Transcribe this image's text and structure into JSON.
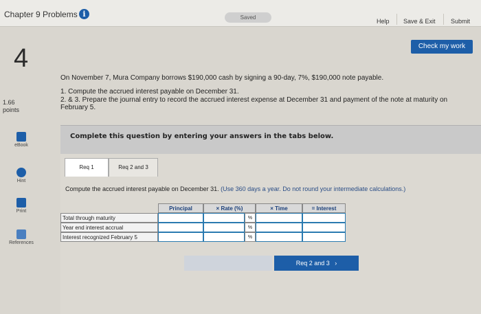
{
  "header": {
    "title": "Chapter 9 Problems",
    "info_icon": "i",
    "status": "Saved",
    "help": "Help",
    "save_exit": "Save & Exit",
    "submit": "Submit"
  },
  "check_work": "Check my work",
  "question": {
    "number": "4",
    "points_value": "1.66",
    "points_label": "points",
    "prompt": "On November 7, Mura Company borrows $190,000 cash by signing a 90-day, 7%, $190,000 note payable.",
    "task1": "1. Compute the accrued interest payable on December 31.",
    "task2": "2. & 3. Prepare the journal entry to record the accrued interest expense at December 31 and payment of the note at maturity on February 5."
  },
  "banner": "Complete this question by entering your answers in the tabs below.",
  "sidebar": {
    "items": [
      {
        "label": "eBook",
        "icon": "ebook-icon"
      },
      {
        "label": "Hint",
        "icon": "hint-icon"
      },
      {
        "label": "Print",
        "icon": "print-icon"
      },
      {
        "label": "References",
        "icon": "references-icon"
      }
    ]
  },
  "tabs": [
    {
      "label": "Req 1"
    },
    {
      "label": "Req 2 and 3"
    }
  ],
  "instruction": {
    "main": "Compute the accrued interest payable on December 31.",
    "note": "(Use 360 days a year. Do not round your intermediate calculations.)"
  },
  "table": {
    "headers": [
      "Principal",
      "× Rate (%)",
      "× Time",
      "= Interest"
    ],
    "rows": [
      {
        "label": "Total through maturity",
        "rate_unit": "%"
      },
      {
        "label": "Year end interest accrual",
        "rate_unit": "%"
      },
      {
        "label": "Interest recognized February 5",
        "rate_unit": "%"
      }
    ]
  },
  "next_button": "Req 2 and 3",
  "colors": {
    "accent": "#1d5ea8"
  }
}
